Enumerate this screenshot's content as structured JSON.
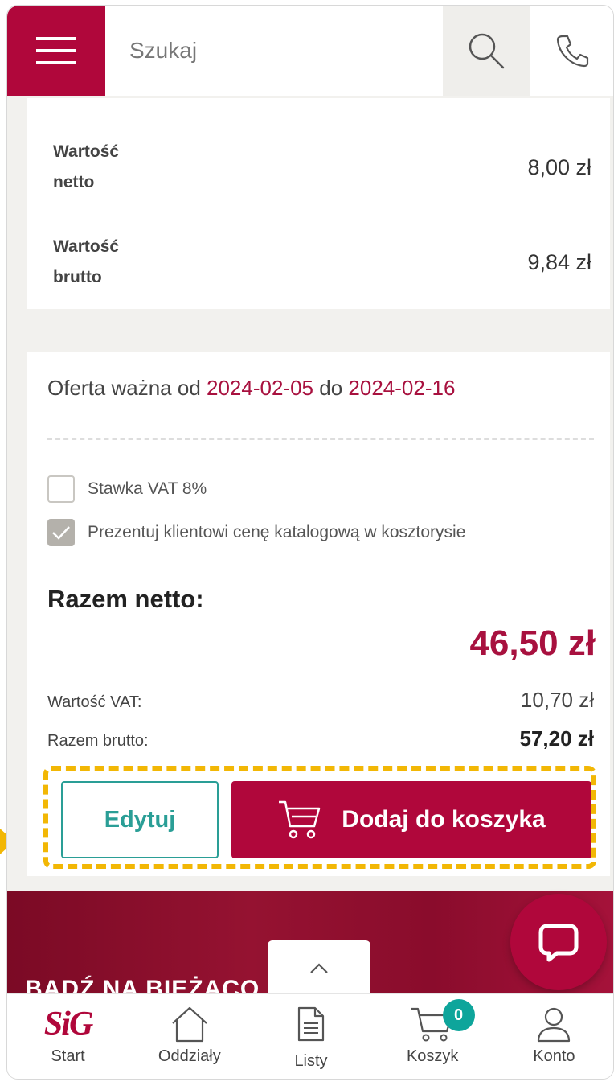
{
  "header": {
    "search_placeholder": "Szukaj"
  },
  "summary": {
    "netto_label": "Wartość netto",
    "netto_value": "8,00 zł",
    "brutto_label": "Wartość brutto",
    "brutto_value": "9,84 zł"
  },
  "offer": {
    "prefix": "Oferta ważna od",
    "from": "2024-02-05",
    "mid": "do",
    "to": "2024-02-16"
  },
  "options": {
    "vat_label": "Stawka VAT 8%",
    "vat_checked": false,
    "catalog_label": "Prezentuj klientowi cenę katalogową w kosztorysie",
    "catalog_checked": true
  },
  "totals": {
    "razem_netto_label": "Razem netto:",
    "razem_netto_value": "46,50 zł",
    "vat_label": "Wartość VAT:",
    "vat_value": "10,70 zł",
    "brutto_label": "Razem brutto:",
    "brutto_value": "57,20 zł"
  },
  "actions": {
    "edit_label": "Edytuj",
    "add_label": "Dodaj do koszyka"
  },
  "promo": {
    "text": "BĄDŹ NA BIEŻĄCO"
  },
  "bottom_nav": {
    "logo": "SiG",
    "start": "Start",
    "branches": "Oddziały",
    "lists": "Listy",
    "cart": "Koszyk",
    "cart_count": "0",
    "account": "Konto"
  },
  "colors": {
    "brand": "#b0073b",
    "accent_teal": "#2a9e96",
    "highlight": "#f2b705"
  }
}
